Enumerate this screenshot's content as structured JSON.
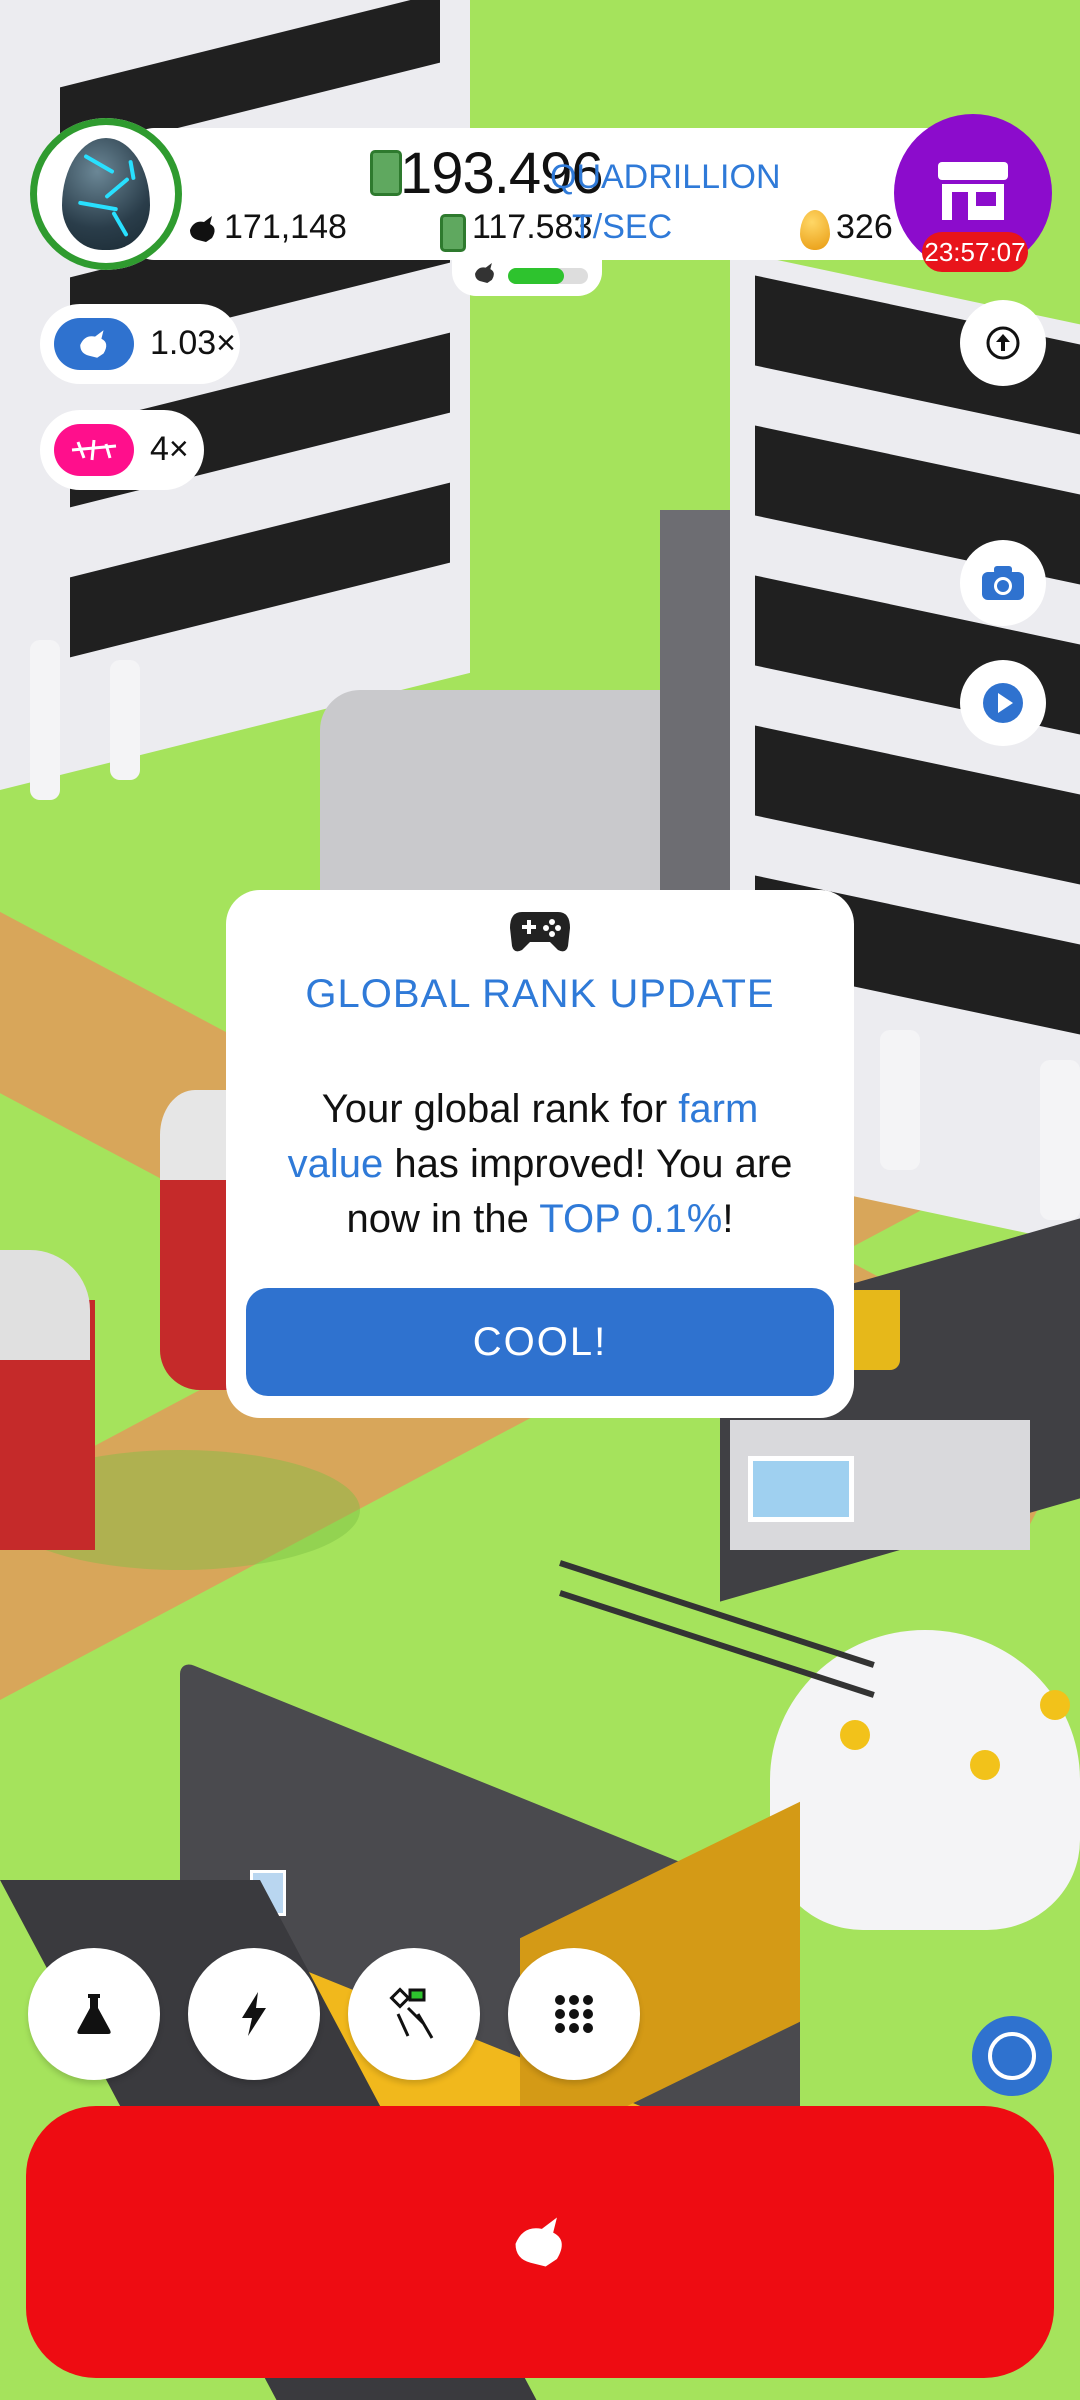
{
  "hud": {
    "chickens": "171,148",
    "money_value": "193.496",
    "money_unit": "QUADRILLION",
    "rate_value": "117.583",
    "rate_unit": "T/SEC",
    "golden_eggs": "326",
    "shop_timer": "23:57:07",
    "progress_fraction": 0.7,
    "boosts": [
      {
        "label": "1.03×",
        "icon": "chicken-icon",
        "color": "#2f72cf"
      },
      {
        "label": "4×",
        "icon": "drone-icon",
        "color": "#ff0f8c"
      }
    ]
  },
  "dialog": {
    "icon": "gamepad-icon",
    "title": "GLOBAL RANK UPDATE",
    "body_1": "Your global rank for ",
    "body_highlight_1": "farm value",
    "body_2": " has improved! You are now in the ",
    "body_highlight_2": "TOP 0.1%",
    "body_3": "!",
    "button": "COOL!"
  },
  "bottom_buttons": [
    "flask-icon",
    "lightning-icon",
    "drone-controller-icon",
    "grid-menu-icon"
  ],
  "colors": {
    "accent_blue": "#2f7ad8",
    "hatch_red": "#ee0c12",
    "shop_purple": "#8c0ccc",
    "grass": "#a5e35c"
  }
}
